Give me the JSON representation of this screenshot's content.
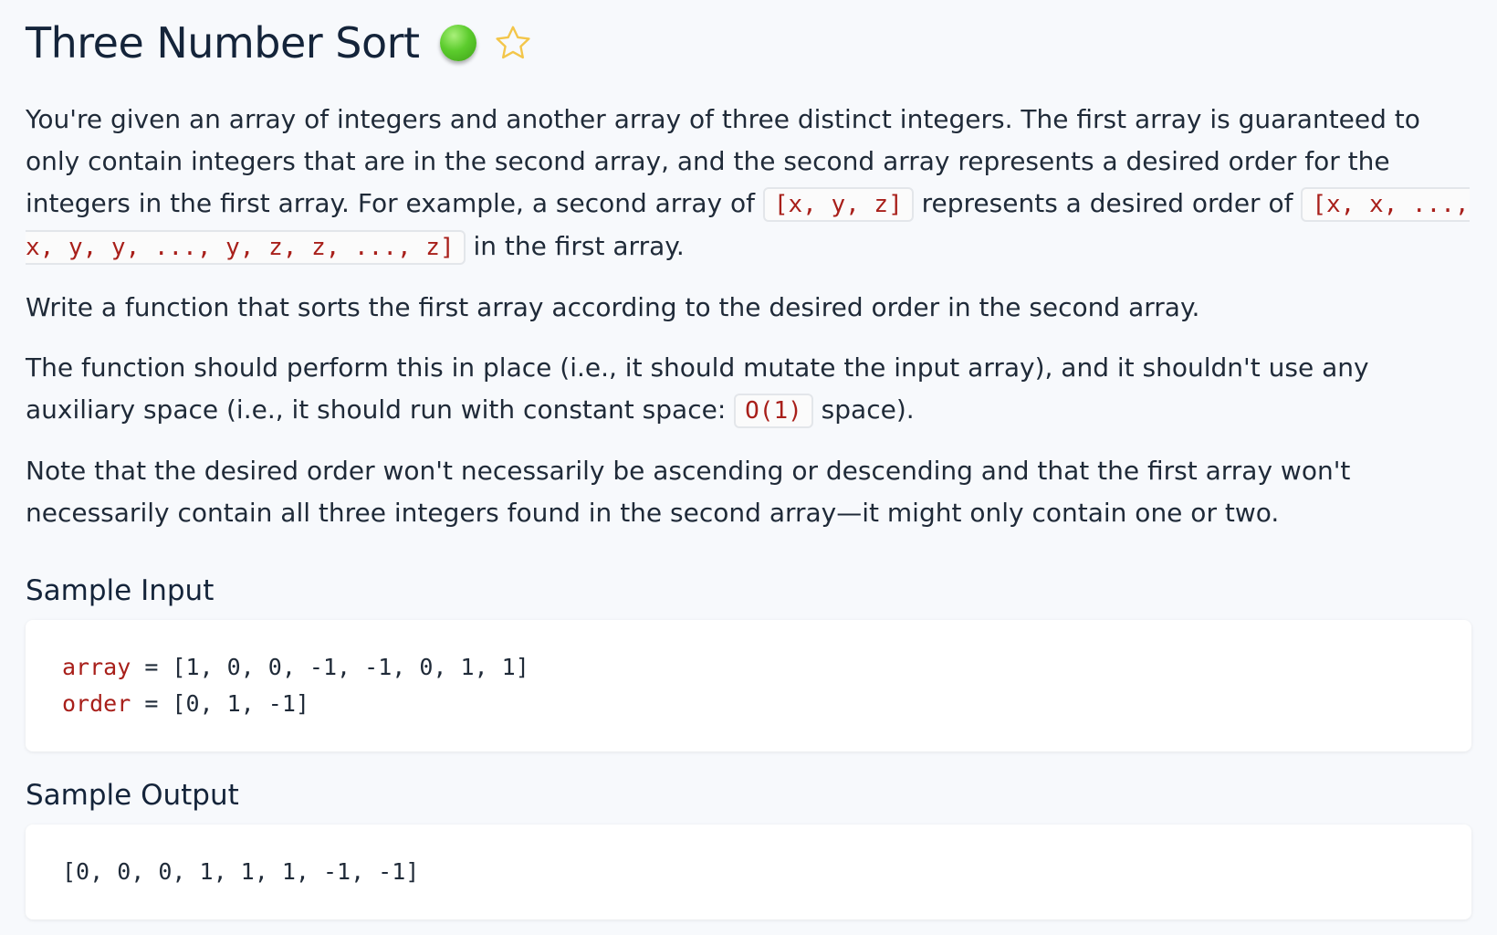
{
  "header": {
    "title": "Three Number Sort",
    "difficulty_color": "#5ccc2d",
    "star_icon": "star-outline-icon"
  },
  "prompt": {
    "p1_text1": "You're given an array of integers and another array of three distinct integers. The first array is guaranteed to only contain integers that are in the second array, and the second array represents a desired order for the integers in the first array. For example, a second array of ",
    "p1_code1": "[x, y, z]",
    "p1_text2": " represents a desired order of ",
    "p1_code2": "[x, x, ..., x, y, y, ..., y, z, z, ..., z]",
    "p1_text3": " in the first array.",
    "p2": "Write a function that sorts the first array according to the desired order in the second array.",
    "p3_text1": "The function should perform this in place (i.e., it should mutate the input array), and it shouldn't use any auxiliary space (i.e., it should run with constant space: ",
    "p3_code": "O(1)",
    "p3_text2": " space).",
    "p4": "Note that the desired order won't necessarily be ascending or descending and that the first array won't necessarily contain all three integers found in the second array—it might only contain one or two."
  },
  "sample_input": {
    "heading": "Sample Input",
    "line1_var": "array",
    "line1_rest": " = [1, 0, 0, -1, -1, 0, 1, 1]",
    "line2_var": "order",
    "line2_rest": " = [0, 1, -1]"
  },
  "sample_output": {
    "heading": "Sample Output",
    "value": "[0, 0, 0, 1, 1, 1, -1, -1]"
  }
}
